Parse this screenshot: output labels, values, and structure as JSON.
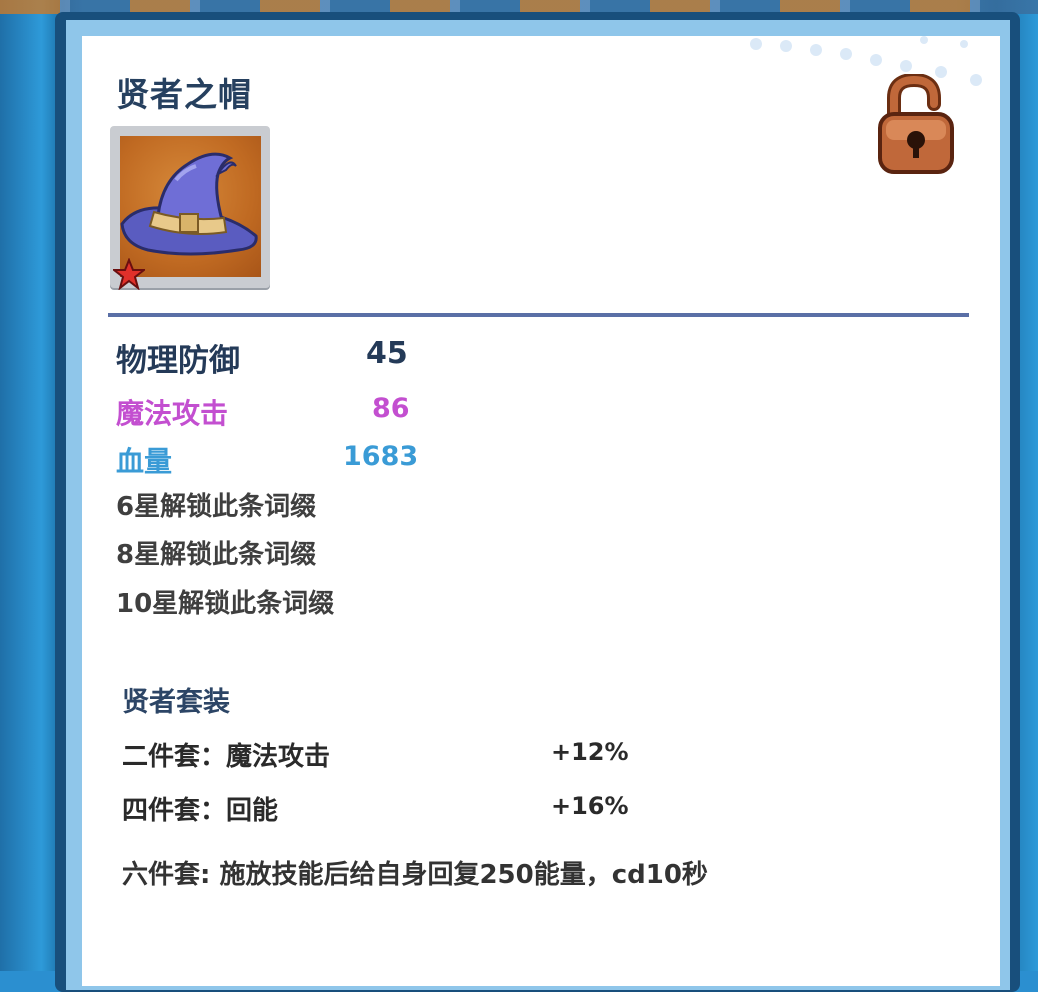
{
  "item": {
    "name": "贤者之帽",
    "icon": "wizard-hat-icon",
    "stars": 1,
    "lock_icon": "unlocked-padlock-icon"
  },
  "stats": {
    "physical_defense": {
      "label": "物理防御",
      "value": "45",
      "color": "#243a58"
    },
    "magic_attack": {
      "label": "魔法攻击",
      "value": "86",
      "color": "#c34fd0"
    },
    "hp": {
      "label": "血量",
      "value": "1683",
      "color": "#3a9bd6"
    }
  },
  "locked_affixes": [
    "6星解锁此条词缀",
    "8星解锁此条词缀",
    "10星解锁此条词缀"
  ],
  "set": {
    "title": "贤者套装",
    "two_piece": {
      "label": "二件套：魔法攻击",
      "bonus": "+12%"
    },
    "four_piece": {
      "label": "四件套：回能",
      "bonus": "+16%"
    },
    "six_piece": "六件套: 施放技能后给自身回复250能量，cd10秒"
  }
}
